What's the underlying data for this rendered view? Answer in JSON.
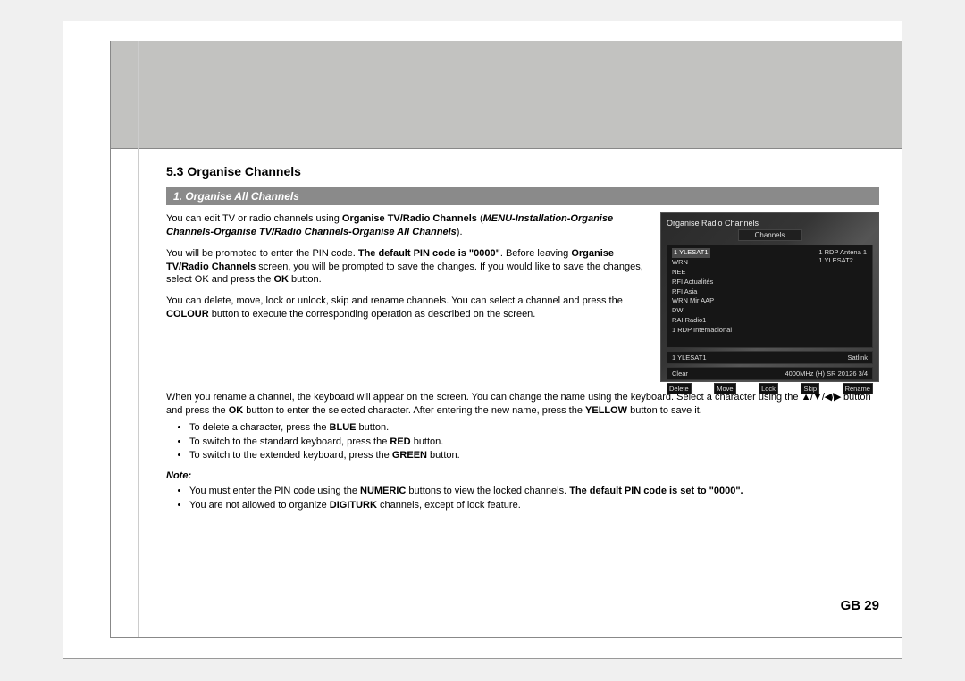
{
  "section_title": "5.3 Organise Channels",
  "subheading": "1. Organise All Channels",
  "p1_a": "You can edit TV or radio channels using ",
  "p1_b": "Organise TV/Radio Channels",
  "p1_c": "MENU-Installation-Organise Channels-Organise TV/Radio Channels-Organise All Channels",
  "p2_a": "You will be prompted to enter the PIN code. ",
  "p2_b": "The default PIN code is \"0000\"",
  "p2_c": "Before leaving ",
  "p2_d": "Organise TV/Radio Channels",
  "p2_e": " screen, you will be prompted to save the changes. If you would like to save the changes, select OK and press the ",
  "p2_f": "OK",
  "p2_g": " button.",
  "p3_a": "You can delete, move, lock or unlock, skip and rename channels. You can select a channel and press the ",
  "p3_b": "COLOUR",
  "p3_c": " button to execute the corresponding operation as described on the screen.",
  "p4_a": "When you rename a channel, the keyboard will appear on the screen. You can change the name using the keyboard. Select a character using the ",
  "arrows": "▲/▼/◀/▶",
  "p4_b": " button and press the ",
  "p4_c": "OK",
  "p4_d": " button to enter the selected character. After entering the new name, press the ",
  "p4_e": "YELLOW",
  "p4_f": " button to save it.",
  "li1_a": "To delete a character, press the ",
  "li1_b": "BLUE",
  "li1_c": " button.",
  "li2_a": "To switch to the standard keyboard, press the ",
  "li2_b": "RED",
  "li2_c": " button.",
  "li3_a": "To switch to the extended keyboard, press the ",
  "li3_b": "GREEN",
  "li3_c": " button.",
  "note_label": "Note:",
  "n1_a": "You must enter the PIN code using the ",
  "n1_b": "NUMERIC",
  "n1_c": " buttons to view the locked channels. ",
  "n1_d": "The default PIN code is set to \"0000\".",
  "n2_a": "You are not allowed to organize ",
  "n2_b": "DIGITURK",
  "n2_c": " channels, except of lock feature.",
  "page_num": "GB 29",
  "shot": {
    "title": "Organise Radio Channels",
    "tab": "Channels",
    "left0": "1 YLESAT1",
    "right0": "1 RDP Antena 1",
    "right1": "1 YLESAT2",
    "items": [
      "WRN",
      "NEE",
      "RFI Actualités",
      "RFI Asia",
      "WRN Mir AAP",
      "DW",
      "RAI Radio1",
      "1 RDP Internacional"
    ],
    "info_l": "1 YLESAT1",
    "info_r": "Satlink",
    "info_l2": "Clear",
    "info_r2": "4000MHz (H) SR 20126 3/4",
    "btns": [
      "Delete",
      "Move",
      "Lock",
      "Skip",
      "Rename"
    ]
  }
}
